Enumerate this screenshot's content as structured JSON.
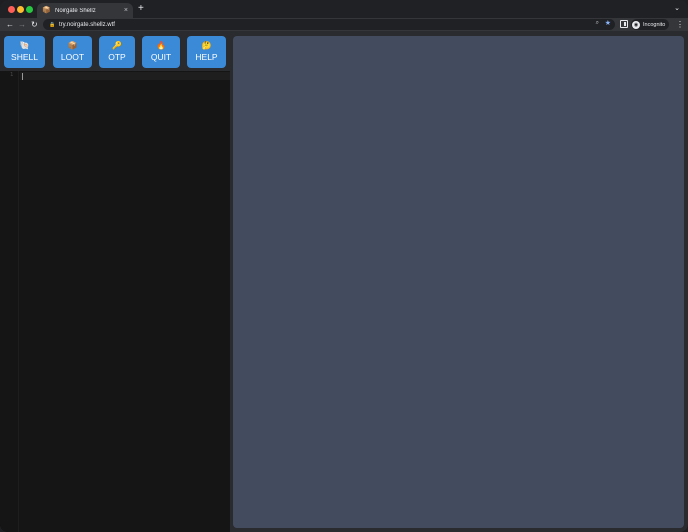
{
  "browser": {
    "tab_title": "Noirgate Shellz",
    "tab_favicon": "📦",
    "tab_close": "×",
    "new_tab": "+",
    "tab_menu": "⌄",
    "url": "try.noirgate.shellz.wtf",
    "incognito_label": "Incognito",
    "nav_back": "←",
    "nav_forward": "→",
    "nav_reload": "↻",
    "lock_icon": "🔒",
    "zoom_icon": "⌕",
    "star_icon": "★",
    "kebab": "⋮"
  },
  "toolbar": {
    "buttons": [
      {
        "emoji": "🐚",
        "label": "SHELL"
      },
      {
        "emoji": "📦",
        "label": "LOOT"
      },
      {
        "emoji": "🔑",
        "label": "OTP"
      },
      {
        "emoji": "🔥",
        "label": "QUIT"
      },
      {
        "emoji": "🤔",
        "label": "HELP"
      }
    ]
  },
  "editor": {
    "line_numbers": [
      "1"
    ]
  },
  "colors": {
    "button": "#3a8ad8",
    "editor_bg": "#151515",
    "terminal_bg": "#434c5e"
  }
}
